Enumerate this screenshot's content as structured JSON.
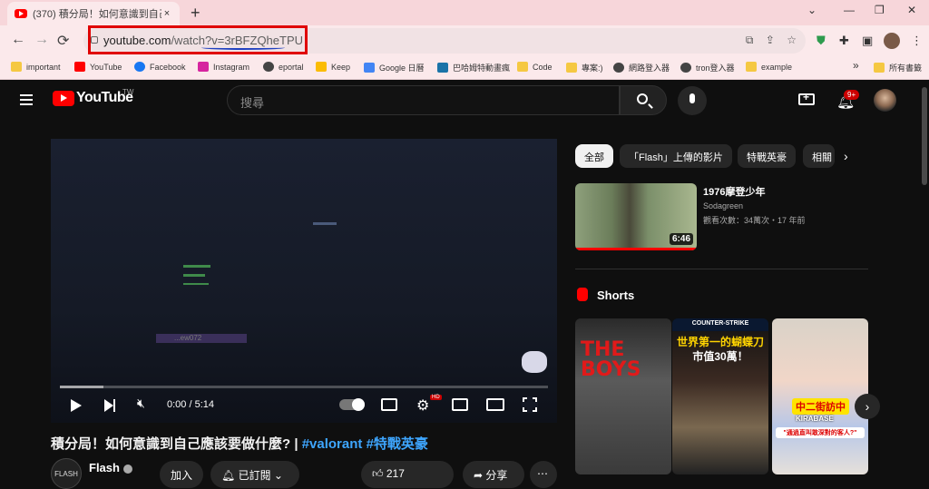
{
  "browser": {
    "tab_title": "(370) 積分局！如何意識到自己應該要做",
    "tab_close": "×",
    "new_tab": "+",
    "url_domain": "youtube.com",
    "url_path": "/watch?v=3rBFZQheTPU",
    "window_controls": [
      "⌄",
      "—",
      "❐",
      "✕"
    ],
    "back": "←",
    "forward": "→",
    "reload": "⟳",
    "bookmarks": [
      {
        "label": "important",
        "icon": "folder-icon"
      },
      {
        "label": "YouTube",
        "icon": "youtube-icon"
      },
      {
        "label": "Facebook",
        "icon": "facebook-icon"
      },
      {
        "label": "Instagram",
        "icon": "instagram-icon"
      },
      {
        "label": "eportal",
        "icon": "globe-icon"
      },
      {
        "label": "Keep",
        "icon": "keep-icon"
      },
      {
        "label": "Google 日曆",
        "icon": "calendar-icon"
      },
      {
        "label": "巴哈姆特動畫瘋",
        "icon": "anime-icon"
      },
      {
        "label": "Code",
        "icon": "folder-icon"
      },
      {
        "label": "專案:)",
        "icon": "folder-icon"
      },
      {
        "label": "網路登入器",
        "icon": "globe-icon"
      },
      {
        "label": "tron登入器",
        "icon": "globe-icon"
      },
      {
        "label": "example",
        "icon": "folder-icon"
      },
      {
        "label": "所有書籤",
        "icon": "folder-icon"
      }
    ],
    "bookmarks_overflow": "»"
  },
  "youtube": {
    "logo_text": "YouTube",
    "region": "TW",
    "search_placeholder": "搜尋",
    "notification_count": "9+",
    "video": {
      "time": "0:00 / 5:14",
      "progress": 0.09,
      "in_game_name": "...ew072",
      "hd_badge": "HD"
    },
    "title": "積分局！如何意識到自己應該要做什麼? | ",
    "hashtags": "#valorant #特戰英豪",
    "channel": {
      "name": "Flash",
      "avatar_text": "FLASH"
    },
    "actions": {
      "join": "加入",
      "subscribed": "已訂閱",
      "likes": "217",
      "share": "分享",
      "more": "⋯"
    },
    "chips": [
      "全部",
      "「Flash」上傳的影片",
      "特戰英豪",
      "相關"
    ],
    "chips_arrow": "›",
    "related": {
      "title": "1976摩登少年",
      "channel": "Sodagreen",
      "meta": "觀看次數：34萬次・17 年前",
      "duration": "6:46"
    },
    "shorts_label": "Shorts",
    "shorts": [
      {
        "text": "THE BOYS"
      },
      {
        "top": "COUNTER-STRIKE",
        "line1": "世界第一的蝴蝶刀",
        "line2": "市值30萬！"
      },
      {
        "tag": "中二街訪中",
        "sub": "KIRABASE",
        "caption": "\"通過直叫敢深對的客人?\""
      }
    ]
  }
}
